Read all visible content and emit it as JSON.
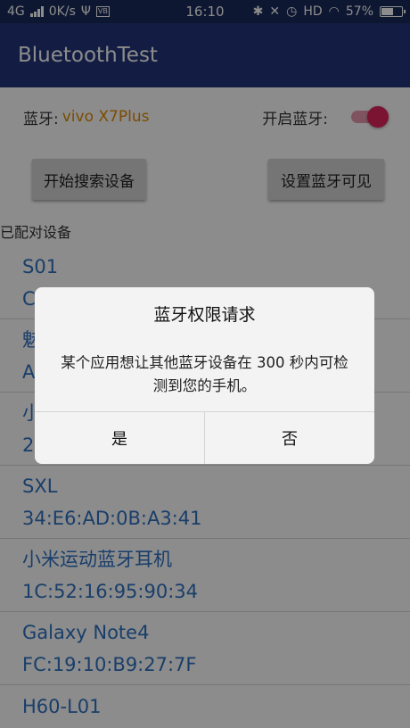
{
  "status_bar": {
    "network": "4G",
    "speed": "0K/s",
    "time": "16:10",
    "hd": "HD",
    "battery_level": "57%",
    "battery_fraction": 0.57
  },
  "app_bar": {
    "title": "BluetoothTest"
  },
  "bluetooth_row": {
    "label": "蓝牙:",
    "device": "vivo X7Plus",
    "switch_label": "开启蓝牙:",
    "switch_on": true
  },
  "buttons": {
    "search": "开始搜索设备",
    "visible": "设置蓝牙可见"
  },
  "paired_header": "已配对设备",
  "devices": [
    {
      "name": "S01",
      "address": "C"
    },
    {
      "name": "魅",
      "address": "A"
    },
    {
      "name": "小",
      "address": "2"
    },
    {
      "name": "SXL",
      "address": "34:E6:AD:0B:A3:41"
    },
    {
      "name": "小米运动蓝牙耳机",
      "address": "1C:52:16:95:90:34"
    },
    {
      "name": "Galaxy Note4",
      "address": "FC:19:10:B9:27:7F"
    },
    {
      "name": "H60-L01",
      "address": ""
    }
  ],
  "dialog": {
    "title": "蓝牙权限请求",
    "message": "某个应用想让其他蓝牙设备在 300 秒内可检测到您的手机。",
    "yes": "是",
    "no": "否"
  },
  "colors": {
    "app_bar": "#24357a",
    "status_bar": "#1a2a5c",
    "device_text": "#2e72c2",
    "device_name_accent": "#e08a00",
    "switch_on": "#e0245e"
  }
}
